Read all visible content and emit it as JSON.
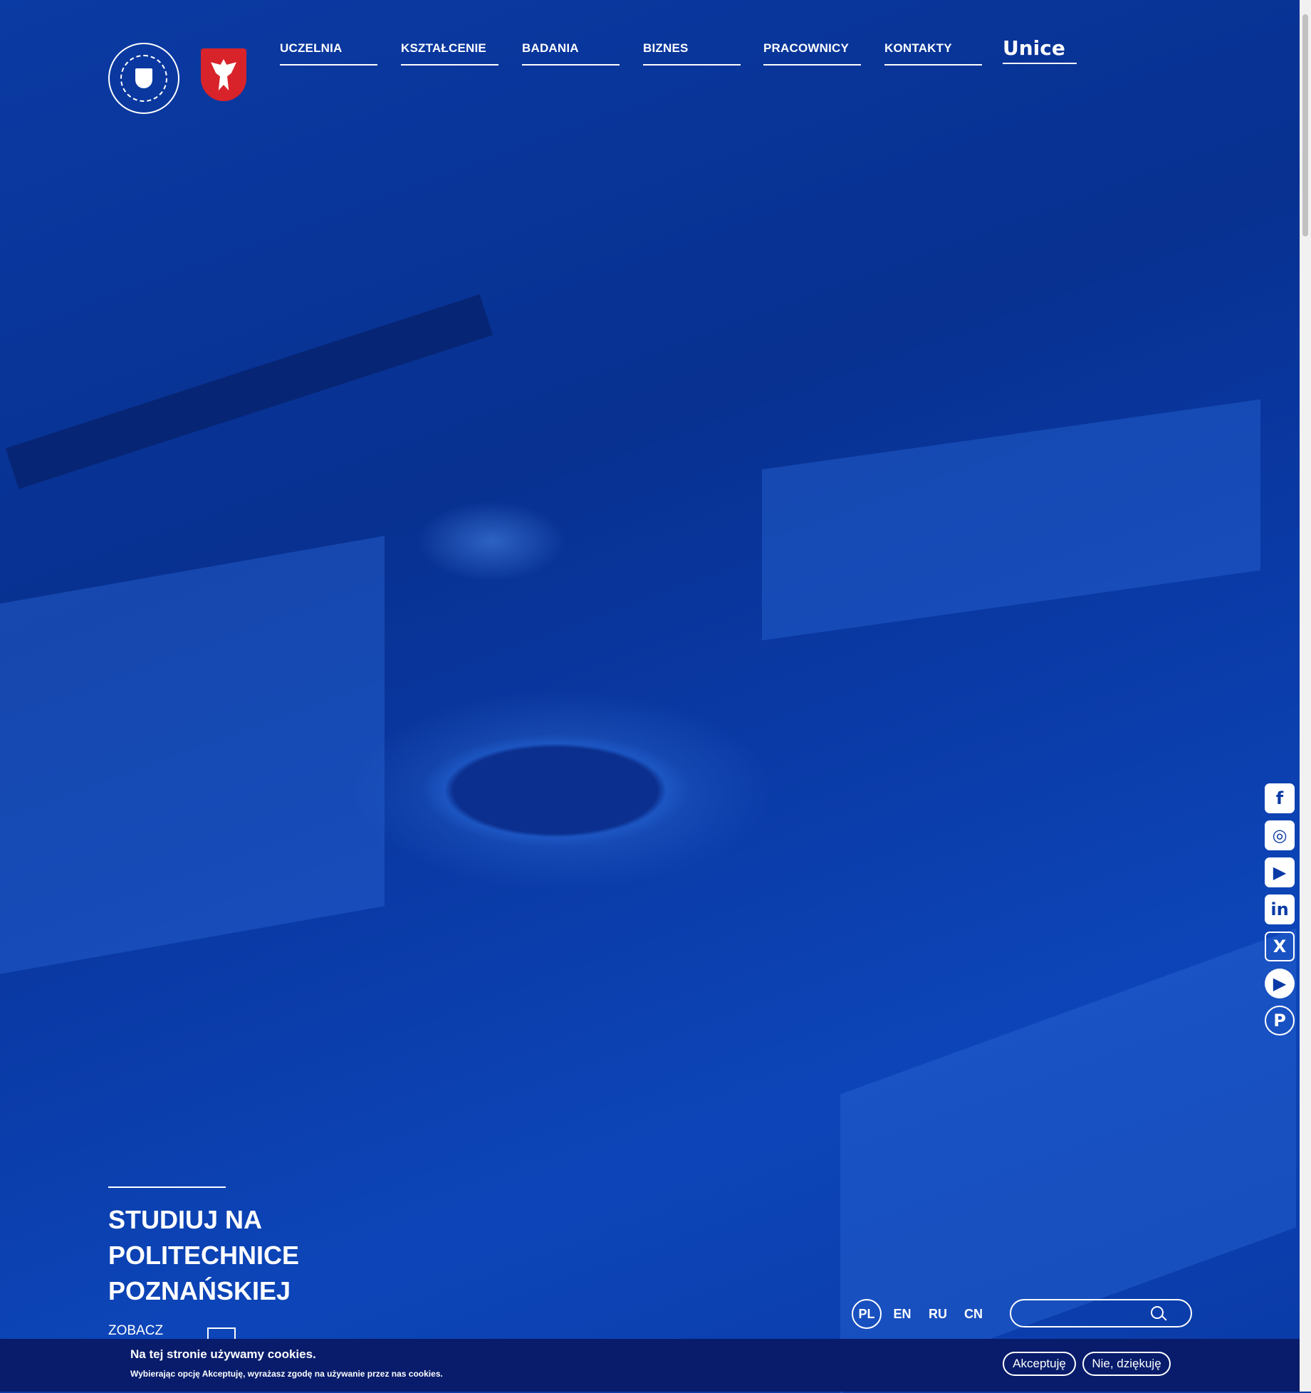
{
  "header": {
    "logo_icon": "university-seal-icon",
    "emblem_icon": "polish-eagle-icon",
    "nav": [
      "UCZELNIA",
      "KSZTAŁCENIE",
      "BADANIA",
      "BIZNES",
      "PRACOWNICY",
      "KONTAKTY"
    ],
    "unice": "Unice"
  },
  "social": [
    "facebook-icon",
    "instagram-icon",
    "youtube-icon",
    "linkedin-icon",
    "x-icon",
    "play-icon",
    "podcast-icon"
  ],
  "hero": {
    "title_lines": [
      "STUDIUJ NA",
      "POLITECHNICE",
      "POZNAŃSKIEJ"
    ],
    "see_more": "ZOBACZ"
  },
  "languages": {
    "items": [
      "PL",
      "EN",
      "RU",
      "CN"
    ],
    "active": "PL"
  },
  "search": {
    "placeholder": ""
  },
  "cookie": {
    "title": "Na tej stronie używamy cookies.",
    "text": "Wybierając opcję Akceptuję, wyrażasz zgodę na używanie przez nas cookies.",
    "accept": "Akceptuję",
    "decline": "Nie, dziękuję"
  },
  "colors": {
    "brand_blue": "#0a3aa6",
    "cookie_bar": "#081c6b",
    "emblem_red": "#d8232a"
  }
}
